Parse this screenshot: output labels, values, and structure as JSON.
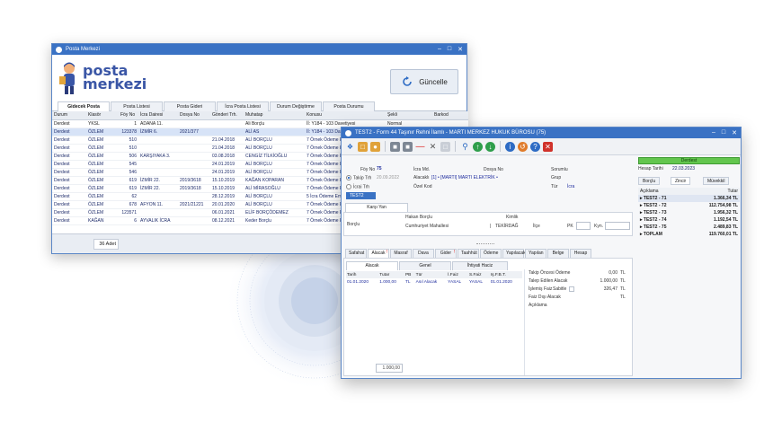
{
  "window1": {
    "title": "Posta Merkezi",
    "brand_line1": "posta",
    "brand_line2": "merkezi",
    "refresh_label": "Güncelle",
    "tabs": [
      "Gidecek Posta",
      "Posta Listesi",
      "Posta Gideri",
      "İcra Posta Listesi",
      "Durum Değiştirme",
      "Posta Durumu"
    ],
    "columns": [
      "Durum",
      "Klasör",
      "Föy No",
      "İcra Dairesi",
      "Dosya No",
      "Gönderi Trh.",
      "Muhatap",
      "Konusu",
      "Şekli",
      "Barkod"
    ],
    "rows": [
      [
        "Derdest",
        "YKSL",
        "1",
        "ADANA 11.",
        "",
        "",
        "Ali Borçlu",
        "İİ: Y184 - 103 Davetiyesi",
        "Normal",
        ""
      ],
      [
        "Derdest",
        "ÖZLEM",
        "123378",
        "İZMİR 6.",
        "2021/377",
        "",
        "ALİ AS",
        "İİ: Y184 - 103 Davetiyesi",
        "Normal",
        ""
      ],
      [
        "Derdest",
        "ÖZLEM",
        "510",
        "",
        "",
        "21.04.2018",
        "ALİ BORÇLU",
        "7 Örnek Ödeme Emri",
        "Normal",
        ""
      ],
      [
        "Derdest",
        "ÖZLEM",
        "510",
        "",
        "",
        "21.04.2018",
        "ALİ BORÇLU",
        "7 Örnek Ödeme Emri",
        "Normal",
        ""
      ],
      [
        "Derdest",
        "ÖZLEM",
        "506",
        "KARŞIYAKA 3.",
        "",
        "03.08.2018",
        "CENGİZ TİLKİOĞLU",
        "7 Örnek Ödeme Emri",
        "Normal",
        ""
      ],
      [
        "Derdest",
        "ÖZLEM",
        "545",
        "",
        "",
        "24.01.2019",
        "ALİ BORÇLU",
        "7 Örnek Ödeme Emri",
        "Normal",
        ""
      ],
      [
        "Derdest",
        "ÖZLEM",
        "546",
        "",
        "",
        "24.01.2019",
        "ALİ BORÇLU",
        "7 Örnek Ödeme Emri",
        "Normal",
        ""
      ],
      [
        "Derdest",
        "ÖZLEM",
        "619",
        "İZMİR 22.",
        "2019/3618",
        "15.10.2019",
        "KAĞAN KOPARAN",
        "7 Örnek Ödeme Emri",
        "Normal",
        ""
      ],
      [
        "Derdest",
        "ÖZLEM",
        "619",
        "İZMİR 22.",
        "2019/3618",
        "15.10.2019",
        "ALİ MİRASOĞLU",
        "7 Örnek Ödeme Emri",
        "Normal",
        ""
      ],
      [
        "Derdest",
        "ÖZLEM",
        "62",
        "",
        "",
        "28.12.2019",
        "ALİ BORÇLU",
        "5 İcra Ödeme Emri",
        "Normal",
        ""
      ],
      [
        "Derdest",
        "ÖZLEM",
        "678",
        "AFYON 11.",
        "2021/21221",
        "20.01.2020",
        "ALİ BORÇLU",
        "7 Örnek Ödeme Emri",
        "Normal",
        ""
      ],
      [
        "Derdest",
        "ÖZLEM",
        "123571",
        "",
        "",
        "06.01.2021",
        "ELİF BORÇÖDEMEZ",
        "7 Örnek Ödeme Emri",
        "Normal",
        ""
      ],
      [
        "Derdest",
        "KAĞAN",
        "6",
        "AYVALIK İCRA",
        "",
        "08.12.2021",
        "Keder Borçlu",
        "7 Örnek Ödeme Emri",
        "Normal",
        ""
      ]
    ],
    "count": "36 Adet"
  },
  "window2": {
    "title": "TEST2 - Form 44 Taşınır Rehni İlamlı - MARTI MERKEZ HUKUK BÜROSU (75)",
    "status": "Derdest",
    "hesap_tarihi_label": "Hesap Tarihi",
    "hesap_tarihi": "22.03.2023",
    "foy_no_label": "Föy No",
    "foy_no": "75",
    "takip_trh_label": "Takip Trh",
    "takip_trh": "20.09.2022",
    "icrai_trh_label": "İcrai Trh",
    "icra_md_label": "İcra Md.",
    "alacakli_label": "Alacaklı",
    "alacakli": "[1] • [MARTI] MARTI ELEKTRİK •",
    "ozel_kod_label": "Özel Kod",
    "dosya_no_label": "Dosya No",
    "sorumlu_label": "Sorumlu",
    "grup_label": "Grup",
    "tur_label": "Tür",
    "tur": "İcra",
    "selected_file": "TEST2",
    "karsi_yan_tab": "Karşı Yan",
    "borclu_label": "Borçlu",
    "borclu_name": "Hakan Borçlu",
    "kimlik_label": "Kimlik",
    "address": "Cumhuriyet Mahallesi",
    "city": "TEKİRDAĞ",
    "ilce_label": "İlçe",
    "pk_label": "PK",
    "kyn_label": "Kyn.",
    "main_tabs": [
      "Safahat",
      "Alacak",
      "Masraf",
      "Dava",
      "Gider",
      "Taahhüt",
      "Ödeme",
      "Yapılacak",
      "Yapılan",
      "Belge",
      "Hesap"
    ],
    "sub_tabs": [
      "Alacak",
      "Genel",
      "İhtiyati Haciz"
    ],
    "alacak_columns": [
      "Tarih",
      "Tutar",
      "PB",
      "Tür",
      "İ.Faiz",
      "S.Faiz",
      "Iş.F.B.T."
    ],
    "alacak_row": [
      "01.01.2020",
      "1.000,00",
      "TL",
      "Asıl Alacak",
      "YASAL",
      "YASAL",
      "01.01.2020"
    ],
    "total": "1.000,00",
    "summary": [
      {
        "label": "Takip Öncesi Ödeme",
        "value": "0,00",
        "unit": "TL"
      },
      {
        "label": "Talep Edilen Alacak",
        "value": "1.000,00",
        "unit": "TL"
      },
      {
        "label": "İşlemiş Faiz",
        "value": "326,47",
        "unit": "TL"
      },
      {
        "label": "Faiz Dışı Alacak",
        "value": "",
        "unit": "TL"
      },
      {
        "label": "Açıklama",
        "value": "",
        "unit": ""
      }
    ],
    "sabitle_label": "Sabitle",
    "right_tabs": [
      "Borçlu",
      "Zincir",
      "Müvekkil"
    ],
    "right_columns": [
      "Açıklama",
      "Tutar"
    ],
    "right_rows": [
      {
        "name": "TEST2 - 71",
        "value": "1.366,34 TL"
      },
      {
        "name": "TEST2 - 72",
        "value": "112.754,98 TL"
      },
      {
        "name": "TEST2 - 73",
        "value": "1.956,32 TL"
      },
      {
        "name": "TEST2 - 74",
        "value": "1.192,54 TL"
      },
      {
        "name": "TEST2 - 75",
        "value": "2.489,83 TL"
      },
      {
        "name": "TOPLAM",
        "value": "119.760,01 TL"
      }
    ]
  }
}
